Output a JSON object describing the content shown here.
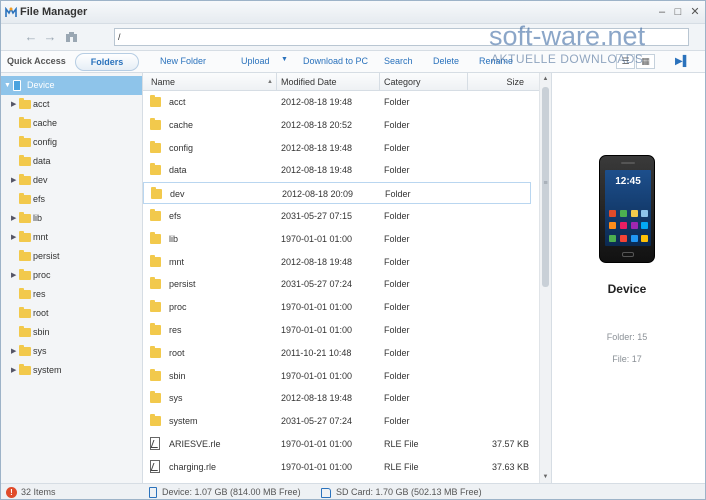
{
  "app": {
    "title": "File Manager"
  },
  "titlebar": {
    "buttons": [
      "–",
      "□",
      "✕"
    ]
  },
  "navbar": {
    "path_value": "/"
  },
  "toolbar": {
    "quick_access": "Quick Access",
    "folders_tab": "Folders",
    "new_folder": "New Folder",
    "upload": "Upload",
    "download": "Download to PC",
    "search": "Search",
    "delete": "Delete",
    "rename": "Rename"
  },
  "sidebar": {
    "root": "Device",
    "items": [
      {
        "label": "acct",
        "expandable": true
      },
      {
        "label": "cache",
        "expandable": false
      },
      {
        "label": "config",
        "expandable": false
      },
      {
        "label": "data",
        "expandable": false
      },
      {
        "label": "dev",
        "expandable": true
      },
      {
        "label": "efs",
        "expandable": false
      },
      {
        "label": "lib",
        "expandable": true
      },
      {
        "label": "mnt",
        "expandable": true
      },
      {
        "label": "persist",
        "expandable": false
      },
      {
        "label": "proc",
        "expandable": true
      },
      {
        "label": "res",
        "expandable": false
      },
      {
        "label": "root",
        "expandable": false
      },
      {
        "label": "sbin",
        "expandable": false
      },
      {
        "label": "sys",
        "expandable": true
      },
      {
        "label": "system",
        "expandable": true
      }
    ]
  },
  "table": {
    "columns": {
      "name": "Name",
      "modified": "Modified Date",
      "category": "Category",
      "size": "Size"
    },
    "rows": [
      {
        "name": "acct",
        "date": "2012-08-18 19:48",
        "category": "Folder",
        "size": "",
        "type": "folder"
      },
      {
        "name": "cache",
        "date": "2012-08-18 20:52",
        "category": "Folder",
        "size": "",
        "type": "folder"
      },
      {
        "name": "config",
        "date": "2012-08-18 19:48",
        "category": "Folder",
        "size": "",
        "type": "folder"
      },
      {
        "name": "data",
        "date": "2012-08-18 19:48",
        "category": "Folder",
        "size": "",
        "type": "folder"
      },
      {
        "name": "dev",
        "date": "2012-08-18 20:09",
        "category": "Folder",
        "size": "",
        "type": "folder"
      },
      {
        "name": "efs",
        "date": "2031-05-27 07:15",
        "category": "Folder",
        "size": "",
        "type": "folder"
      },
      {
        "name": "lib",
        "date": "1970-01-01 01:00",
        "category": "Folder",
        "size": "",
        "type": "folder"
      },
      {
        "name": "mnt",
        "date": "2012-08-18 19:48",
        "category": "Folder",
        "size": "",
        "type": "folder"
      },
      {
        "name": "persist",
        "date": "2031-05-27 07:24",
        "category": "Folder",
        "size": "",
        "type": "folder"
      },
      {
        "name": "proc",
        "date": "1970-01-01 01:00",
        "category": "Folder",
        "size": "",
        "type": "folder"
      },
      {
        "name": "res",
        "date": "1970-01-01 01:00",
        "category": "Folder",
        "size": "",
        "type": "folder"
      },
      {
        "name": "root",
        "date": "2011-10-21 10:48",
        "category": "Folder",
        "size": "",
        "type": "folder"
      },
      {
        "name": "sbin",
        "date": "1970-01-01 01:00",
        "category": "Folder",
        "size": "",
        "type": "folder"
      },
      {
        "name": "sys",
        "date": "2012-08-18 19:48",
        "category": "Folder",
        "size": "",
        "type": "folder"
      },
      {
        "name": "system",
        "date": "2031-05-27 07:24",
        "category": "Folder",
        "size": "",
        "type": "folder"
      },
      {
        "name": "ARIESVE.rle",
        "date": "1970-01-01 01:00",
        "category": "RLE File",
        "size": "37.57 KB",
        "type": "file"
      },
      {
        "name": "charging.rle",
        "date": "1970-01-01 01:00",
        "category": "RLE File",
        "size": "37.63 KB",
        "type": "file"
      }
    ]
  },
  "preview": {
    "device_name": "Device",
    "phone_clock": "12:45",
    "folder_count": "Folder: 15",
    "file_count": "File: 17"
  },
  "status": {
    "items": "32 Items",
    "device": "Device: 1.07 GB (814.00 MB Free)",
    "sdcard": "SD Card: 1.70 GB (502.13 MB Free)"
  },
  "watermark": {
    "main": "soft-ware.net",
    "sub": "AKTUELLE DOWNLOADS"
  },
  "colors": {
    "accent": "#2a72bc",
    "selection": "#8ec4ea",
    "folder": "#f2c94c"
  }
}
